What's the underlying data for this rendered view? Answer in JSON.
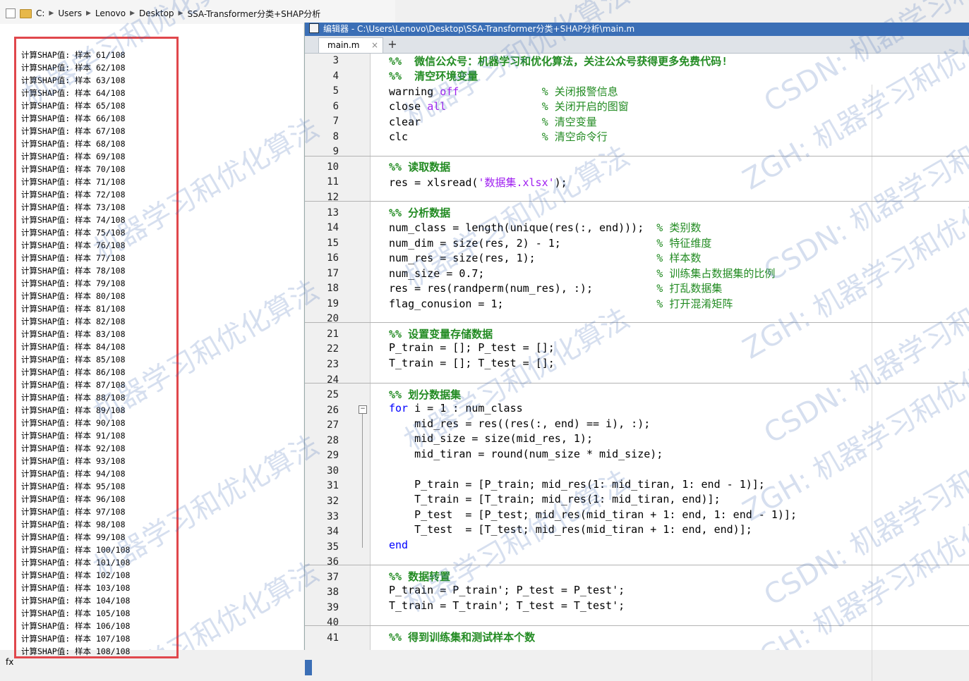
{
  "address_bar": {
    "crumbs": [
      "C:",
      "Users",
      "Lenovo",
      "Desktop",
      "SSA-Transformer分类+SHAP分析"
    ]
  },
  "command_window": {
    "lines": [
      "计算SHAP值: 样本 61/108",
      "计算SHAP值: 样本 62/108",
      "计算SHAP值: 样本 63/108",
      "计算SHAP值: 样本 64/108",
      "计算SHAP值: 样本 65/108",
      "计算SHAP值: 样本 66/108",
      "计算SHAP值: 样本 67/108",
      "计算SHAP值: 样本 68/108",
      "计算SHAP值: 样本 69/108",
      "计算SHAP值: 样本 70/108",
      "计算SHAP值: 样本 71/108",
      "计算SHAP值: 样本 72/108",
      "计算SHAP值: 样本 73/108",
      "计算SHAP值: 样本 74/108",
      "计算SHAP值: 样本 75/108",
      "计算SHAP值: 样本 76/108",
      "计算SHAP值: 样本 77/108",
      "计算SHAP值: 样本 78/108",
      "计算SHAP值: 样本 79/108",
      "计算SHAP值: 样本 80/108",
      "计算SHAP值: 样本 81/108",
      "计算SHAP值: 样本 82/108",
      "计算SHAP值: 样本 83/108",
      "计算SHAP值: 样本 84/108",
      "计算SHAP值: 样本 85/108",
      "计算SHAP值: 样本 86/108",
      "计算SHAP值: 样本 87/108",
      "计算SHAP值: 样本 88/108",
      "计算SHAP值: 样本 89/108",
      "计算SHAP值: 样本 90/108",
      "计算SHAP值: 样本 91/108",
      "计算SHAP值: 样本 92/108",
      "计算SHAP值: 样本 93/108",
      "计算SHAP值: 样本 94/108",
      "计算SHAP值: 样本 95/108",
      "计算SHAP值: 样本 96/108",
      "计算SHAP值: 样本 97/108",
      "计算SHAP值: 样本 98/108",
      "计算SHAP值: 样本 99/108",
      "计算SHAP值: 样本 100/108",
      "计算SHAP值: 样本 101/108",
      "计算SHAP值: 样本 102/108",
      "计算SHAP值: 样本 103/108",
      "计算SHAP值: 样本 104/108",
      "计算SHAP值: 样本 105/108",
      "计算SHAP值: 样本 106/108",
      "计算SHAP值: 样本 107/108",
      "计算SHAP值: 样本 108/108"
    ],
    "prompt": "fx"
  },
  "editor": {
    "title": "编辑器 - C:\\Users\\Lenovo\\Desktop\\SSA-Transformer分类+SHAP分析\\main.m",
    "tab_label": "main.m",
    "tab_close": "×",
    "tab_add": "+",
    "line_numbers": [
      "3",
      "4",
      "5",
      "6",
      "7",
      "8",
      "9",
      "10",
      "11",
      "12",
      "13",
      "14",
      "15",
      "16",
      "17",
      "18",
      "19",
      "20",
      "21",
      "22",
      "23",
      "24",
      "25",
      "26",
      "27",
      "28",
      "29",
      "30",
      "31",
      "32",
      "33",
      "34",
      "35",
      "36",
      "37",
      "38",
      "39",
      "40",
      "41"
    ],
    "fold_symbol": "−"
  },
  "watermark": {
    "texts": [
      "机器学习和优化算法",
      "ZGH: 机器学习和优化",
      "CSDN: 机器学习和优化"
    ]
  },
  "colors": {
    "accent": "#3b6fb6",
    "comment": "#228b22",
    "keyword": "#0000ff",
    "string": "#a020f0",
    "highlight_frame": "#e0474c"
  }
}
